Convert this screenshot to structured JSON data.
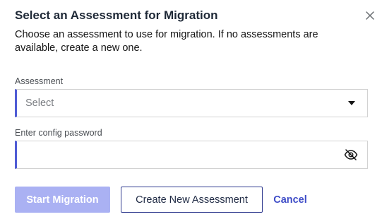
{
  "dialog": {
    "title": "Select an Assessment for Migration",
    "description": "Choose an assessment to use for migration. If no assessments are available, create a new one.",
    "close_icon": "close-icon"
  },
  "fields": {
    "assessment": {
      "label": "Assessment",
      "placeholder": "Select",
      "icon": "caret-down-icon"
    },
    "password": {
      "label": "Enter config password",
      "value": "",
      "icon": "eye-slash-icon"
    }
  },
  "actions": {
    "start": "Start Migration",
    "create": "Create New Assessment",
    "cancel": "Cancel"
  },
  "colors": {
    "accent": "#4f5bd5",
    "primary_disabled": "#aab1f3",
    "link": "#3e4cc7"
  }
}
